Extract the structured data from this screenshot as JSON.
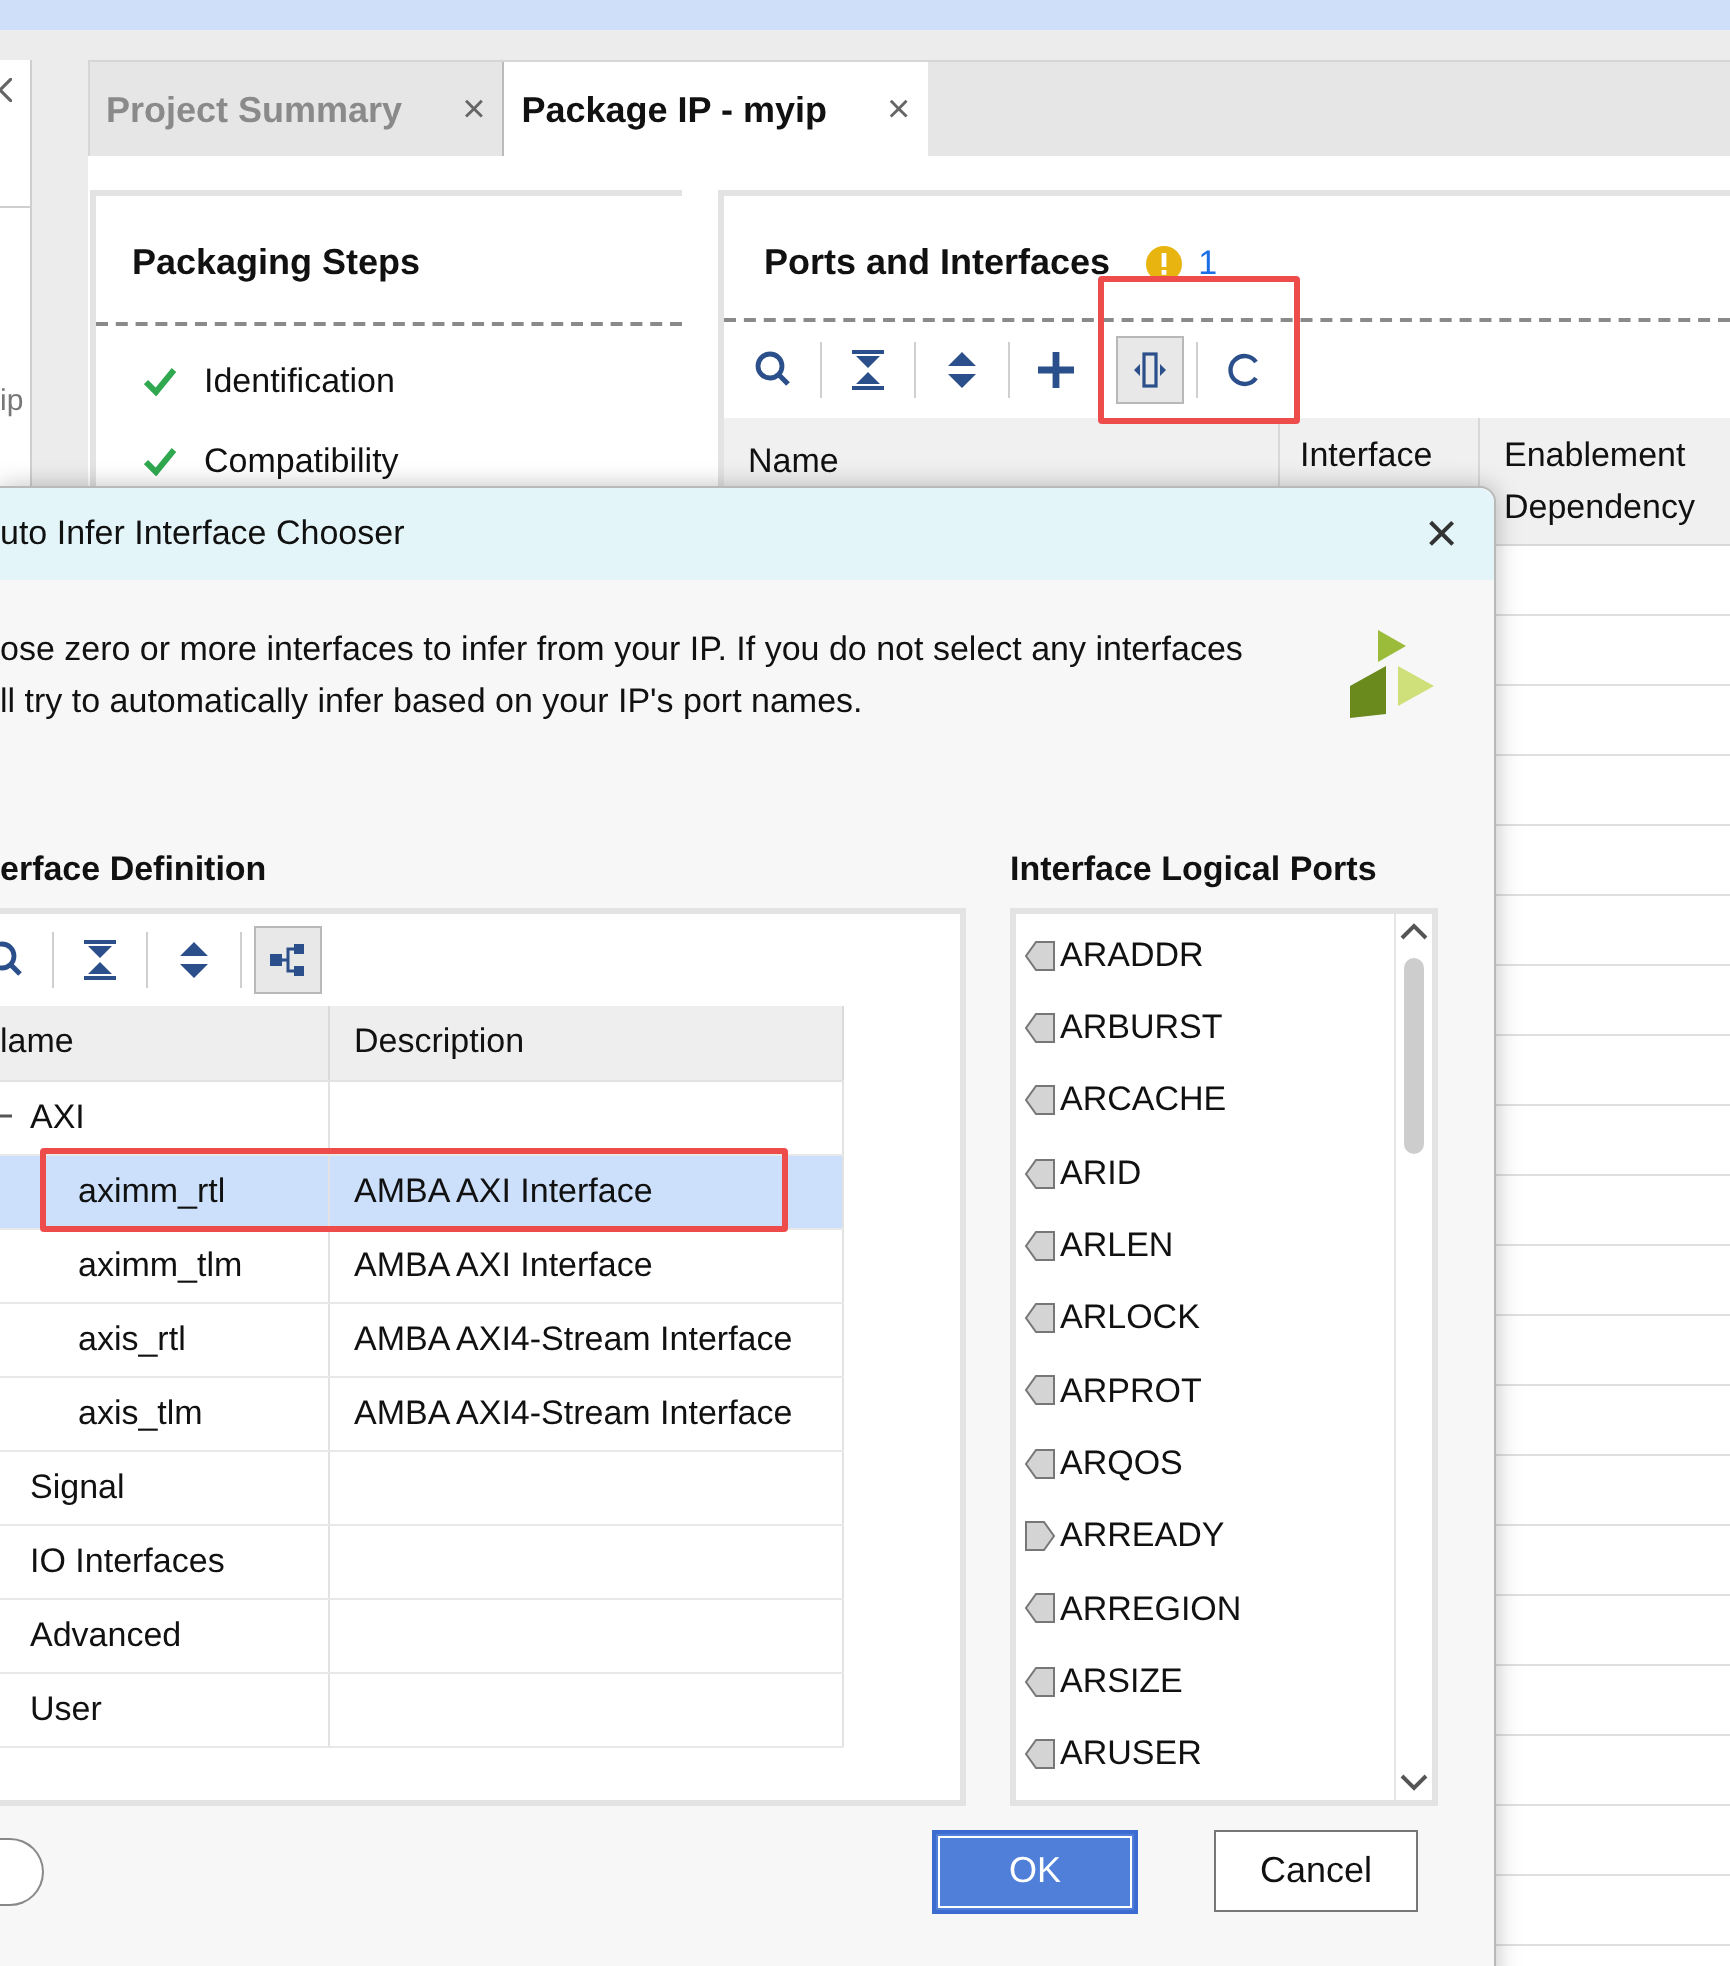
{
  "left_panel": {
    "label": "ip"
  },
  "tabs": [
    {
      "label": "Project Summary",
      "close": "×",
      "selected": false
    },
    {
      "label": "Package IP - myip",
      "close": "×",
      "selected": true
    }
  ],
  "packaging_steps": {
    "title": "Packaging Steps",
    "items": [
      {
        "label": "Identification",
        "done": true
      },
      {
        "label": "Compatibility",
        "done": true
      }
    ]
  },
  "ports_panel": {
    "title": "Ports and Interfaces",
    "warning_count": "1",
    "toolbar": [
      {
        "kind": "search",
        "pressed": false
      },
      {
        "kind": "collapse",
        "pressed": false
      },
      {
        "kind": "expand",
        "pressed": false
      },
      {
        "kind": "add",
        "pressed": false
      },
      {
        "kind": "infer",
        "pressed": true
      },
      {
        "kind": "refresh",
        "pressed": false
      }
    ],
    "columns": [
      "Name",
      "Interface",
      "Enablement Dependency"
    ]
  },
  "dialog": {
    "title": "uto Infer Interface Chooser",
    "close": "×",
    "message": [
      "ose zero or more interfaces to infer from your IP. If you do not select any interfaces",
      "ll try to automatically infer based on your IP's port names."
    ],
    "definition": {
      "title": "erface Definition",
      "toolbar": [
        {
          "kind": "search",
          "pressed": false
        },
        {
          "kind": "collapse",
          "pressed": false
        },
        {
          "kind": "expand",
          "pressed": false
        },
        {
          "kind": "hierarchy",
          "pressed": true
        }
      ],
      "columns": [
        "lame",
        "Description"
      ],
      "rows": [
        {
          "name": "AXI",
          "description": "",
          "selected": false,
          "expanded": true,
          "children": [
            {
              "name": "aximm_rtl",
              "description": "AMBA AXI Interface",
              "selected": true
            },
            {
              "name": "aximm_tlm",
              "description": "AMBA AXI Interface",
              "selected": false
            },
            {
              "name": "axis_rtl",
              "description": "AMBA AXI4-Stream Interface",
              "selected": false
            },
            {
              "name": "axis_tlm",
              "description": "AMBA AXI4-Stream Interface",
              "selected": false
            }
          ]
        },
        {
          "name": "Signal",
          "description": "",
          "selected": false
        },
        {
          "name": "IO Interfaces",
          "description": "",
          "selected": false
        },
        {
          "name": "Advanced",
          "description": "",
          "selected": false
        },
        {
          "name": "User",
          "description": "",
          "selected": false
        }
      ]
    },
    "logical_ports": {
      "title": "Interface Logical Ports",
      "items": [
        {
          "name": "ARADDR",
          "kind": "input"
        },
        {
          "name": "ARBURST",
          "kind": "input"
        },
        {
          "name": "ARCACHE",
          "kind": "input"
        },
        {
          "name": "ARID",
          "kind": "input"
        },
        {
          "name": "ARLEN",
          "kind": "input"
        },
        {
          "name": "ARLOCK",
          "kind": "input"
        },
        {
          "name": "ARPROT",
          "kind": "input"
        },
        {
          "name": "ARQOS",
          "kind": "input"
        },
        {
          "name": "ARREADY",
          "kind": "output"
        },
        {
          "name": "ARREGION",
          "kind": "input"
        },
        {
          "name": "ARSIZE",
          "kind": "input"
        },
        {
          "name": "ARUSER",
          "kind": "input"
        }
      ]
    },
    "buttons": [
      {
        "label": "OK",
        "kind": "primary"
      },
      {
        "label": "Cancel",
        "kind": "secondary"
      }
    ]
  }
}
